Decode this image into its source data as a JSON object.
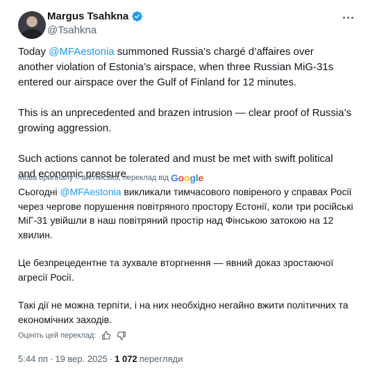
{
  "author": {
    "name": "Margus Tsahkna",
    "handle": "@Tsahkna"
  },
  "tweet": {
    "p1_prefix": "Today ",
    "p1_mention": "@MFAestonia",
    "p1_suffix": " summoned Russia’s chargé d’affaires over another violation of Estonia’s airspace, when three Russian MiG-31s entered our airspace over the Gulf of Finland for 12 minutes.",
    "p2": "This is an unprecedented and brazen intrusion — clear proof of Russia’s growing aggression.",
    "p3": "Such actions cannot be tolerated and must be met with swift political and economic pressure."
  },
  "translation": {
    "note": "Мова оригіналу – англійська, переклад від",
    "provider": "Google",
    "p1_prefix": "Сьогодні ",
    "p1_mention": "@MFAestonia",
    "p1_suffix": " викликали тимчасового повіреного у справах Росії через чергове порушення повітряного простору Естонії, коли три російські МіГ-31 увійшли в наш повітряний простір над Фінською затокою на 12 хвилин.",
    "p2": "Це безпрецедентне та зухвале вторгнення — явний доказ зростаючої агресії Росії.",
    "p3": "Такі дії не можна терпіти, і на них необхідно негайно вжити політичних та економічних заходів.",
    "rate_label": "Оцініть цей переклад:"
  },
  "meta": {
    "time": "5:44 пп",
    "separator": "·",
    "date": "19 вер. 2025",
    "views_count": "1 072",
    "views_label": "перегляди"
  },
  "colors": {
    "accent": "#1d9bf0",
    "text": "#0f1419",
    "muted": "#536471"
  }
}
